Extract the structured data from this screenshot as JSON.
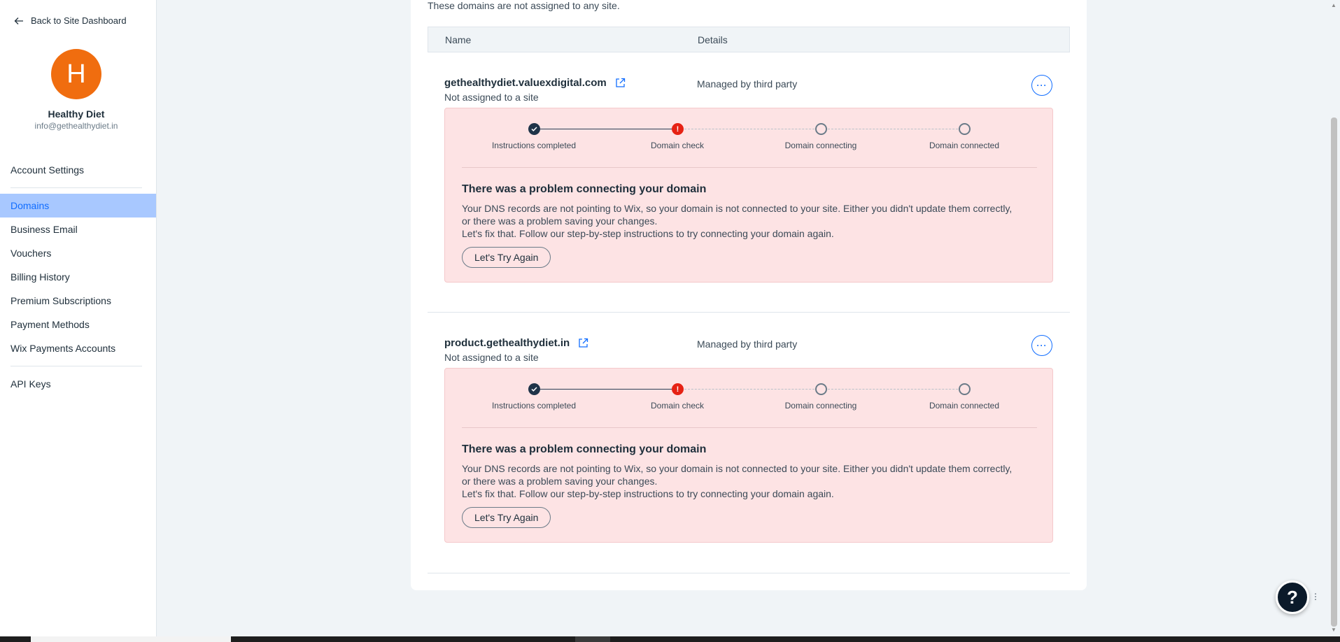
{
  "sidebar": {
    "back_label": "Back to Site Dashboard",
    "avatar_letter": "H",
    "profile_name": "Healthy Diet",
    "profile_email": "info@gethealthydiet.in",
    "items_top": [
      "Account Settings"
    ],
    "items_main": [
      "Domains",
      "Business Email",
      "Vouchers",
      "Billing History",
      "Premium Subscriptions",
      "Payment Methods",
      "Wix Payments Accounts"
    ],
    "items_bottom": [
      "API Keys"
    ],
    "active_item": "Domains"
  },
  "main": {
    "intro": "These domains are not assigned to any site.",
    "columns": {
      "name": "Name",
      "details": "Details"
    },
    "domains": [
      {
        "name": "gethealthydiet.valuexdigital.com",
        "status": "Not assigned to a site",
        "details": "Managed by third party",
        "steps": [
          "Instructions completed",
          "Domain check",
          "Domain connecting",
          "Domain connected"
        ],
        "problem_title": "There was a problem connecting your domain",
        "problem_line1": "Your DNS records are not pointing to Wix, so your domain is not connected to your site. Either you didn't update them correctly, or there was a problem saving your changes.",
        "problem_line2": "Let's fix that. Follow our step-by-step instructions to try connecting your domain again.",
        "retry_label": "Let's Try Again"
      },
      {
        "name": "product.gethealthydiet.in",
        "status": "Not assigned to a site",
        "details": "Managed by third party",
        "steps": [
          "Instructions completed",
          "Domain check",
          "Domain connecting",
          "Domain connected"
        ],
        "problem_title": "There was a problem connecting your domain",
        "problem_line1": "Your DNS records are not pointing to Wix, so your domain is not connected to your site. Either you didn't update them correctly, or there was a problem saving your changes.",
        "problem_line2": "Let's fix that. Follow our step-by-step instructions to try connecting your domain again.",
        "retry_label": "Let's Try Again"
      }
    ],
    "more_label": "···"
  },
  "help": {
    "label": "?"
  },
  "colors": {
    "accent": "#116dff",
    "active_nav_bg": "#a8c8ff",
    "avatar": "#f06d0f",
    "error_bg": "#fde3e4",
    "error_node": "#e62214"
  }
}
